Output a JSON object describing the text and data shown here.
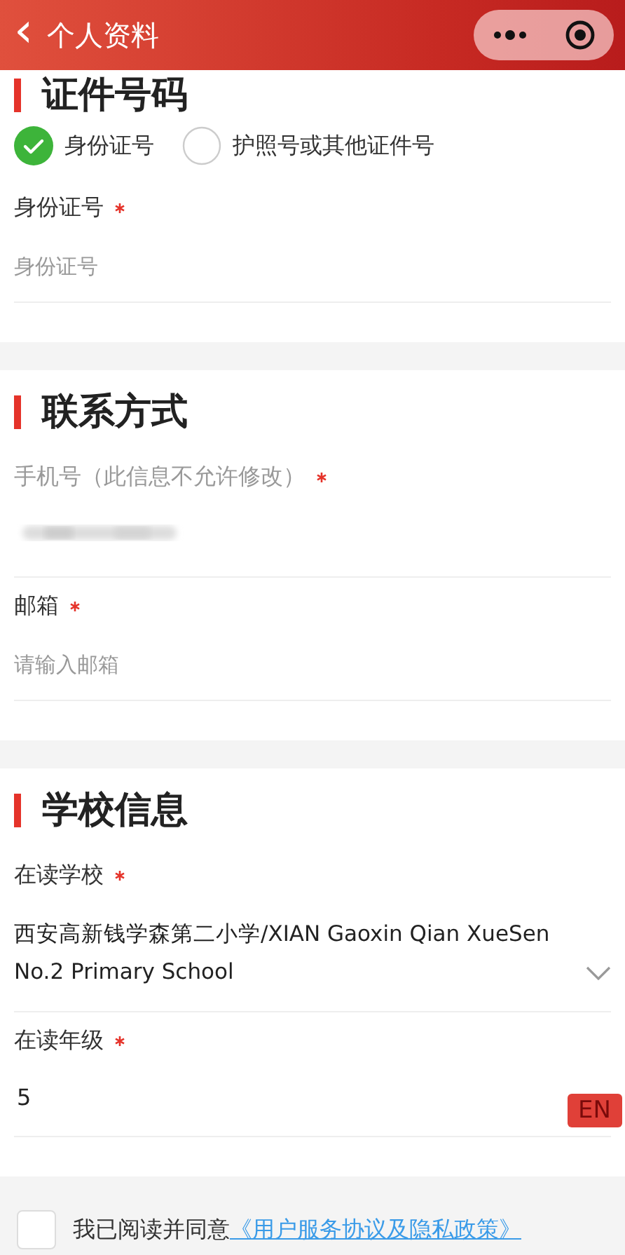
{
  "header": {
    "back": "‹",
    "title": "个人资料"
  },
  "sections": [
    {
      "title": "证件号码",
      "id_type": [
        {
          "label": "身份证号",
          "selected": true
        },
        {
          "label": "护照号或其他证件号",
          "selected": false
        }
      ],
      "fields": [
        {
          "label": "身份证号",
          "required": true,
          "muted": false,
          "placeholder": "身份证号",
          "kind": "input"
        }
      ]
    },
    {
      "title": "联系方式",
      "fields": [
        {
          "label": "手机号（此信息不允许修改）",
          "required": true,
          "muted": true,
          "kind": "redacted"
        },
        {
          "label": "邮箱",
          "required": true,
          "muted": false,
          "placeholder": "请输入邮箱",
          "kind": "input"
        }
      ]
    },
    {
      "title": "学校信息",
      "fields": [
        {
          "label": "在读学校",
          "required": true,
          "muted": false,
          "value": "西安高新钱学森第二小学/XIAN Gaoxin Qian XueSen No.2 Primary School",
          "kind": "select"
        },
        {
          "label": "在读年级",
          "required": true,
          "muted": false,
          "value": "5",
          "kind": "input"
        }
      ]
    }
  ],
  "lang_badge": "EN",
  "agreement": {
    "checked": false,
    "text": "我已阅读并同意",
    "link": "《用户服务协议及隐私政策》"
  }
}
